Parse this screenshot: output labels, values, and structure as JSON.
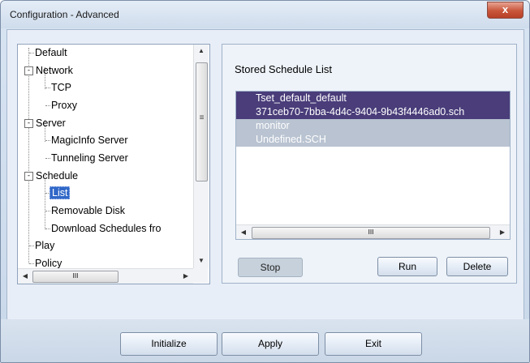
{
  "window": {
    "title": "Configuration - Advanced",
    "close_glyph": "x"
  },
  "tree": {
    "items": [
      {
        "label": "Default"
      },
      {
        "label": "Network",
        "expander": "-"
      },
      {
        "label": "TCP"
      },
      {
        "label": "Proxy"
      },
      {
        "label": "Server",
        "expander": "-"
      },
      {
        "label": "MagicInfo Server"
      },
      {
        "label": "Tunneling Server"
      },
      {
        "label": "Schedule",
        "expander": "-"
      },
      {
        "label": "List",
        "selected": true
      },
      {
        "label": "Removable Disk"
      },
      {
        "label": "Download Schedules fro"
      },
      {
        "label": "Play"
      },
      {
        "label": "Policy"
      }
    ],
    "scroll_up_glyph": "▲",
    "scroll_down_glyph": "▼",
    "scroll_grip_glyph": "≡",
    "scroll_left_glyph": "◀",
    "scroll_right_glyph": "▶",
    "hscroll_grip_glyph": "III"
  },
  "schedule_panel": {
    "title": "Stored Schedule List",
    "items": [
      {
        "lines": [
          "Tset_default_default",
          "371ceb70-7bba-4d4c-9404-9b43f4446ad0.sch"
        ],
        "state": "selected"
      },
      {
        "lines": [
          "monitor",
          "Undefined.SCH"
        ],
        "state": "highlighted"
      }
    ],
    "hscroll_grip_glyph": "III",
    "scroll_left_glyph": "◀",
    "scroll_right_glyph": "▶",
    "stop_label": "Stop",
    "run_label": "Run",
    "delete_label": "Delete"
  },
  "footer": {
    "initialize_label": "Initialize",
    "apply_label": "Apply",
    "exit_label": "Exit"
  }
}
